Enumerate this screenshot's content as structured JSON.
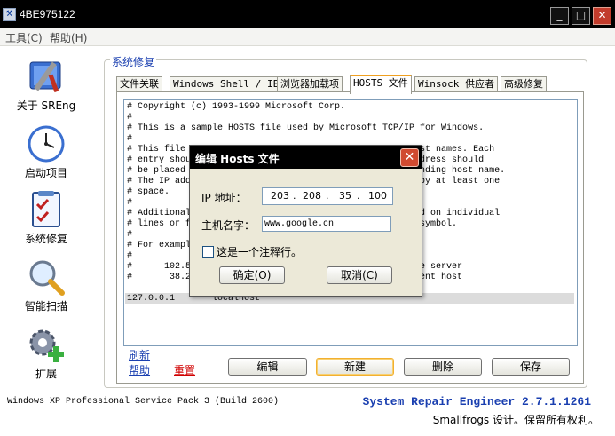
{
  "window": {
    "title": "4BE975122",
    "min": "_",
    "max": "□",
    "close": "✕"
  },
  "menu": [
    "工具(C)",
    "帮助(H)"
  ],
  "sidebar": [
    {
      "label": "关于 SREng",
      "icon": "tools-icon"
    },
    {
      "label": "启动项目",
      "icon": "clock-icon"
    },
    {
      "label": "系统修复",
      "icon": "checklist-icon"
    },
    {
      "label": "智能扫描",
      "icon": "magnifier-icon"
    },
    {
      "label": "扩展",
      "icon": "gear-plus-icon"
    }
  ],
  "group_title": "系统修复",
  "tabs": [
    "文件关联",
    "Windows Shell / IE",
    "浏览器加载项",
    "HOSTS 文件",
    "Winsock 供应者",
    "高级修复"
  ],
  "hosts_lines": [
    "# Copyright (c) 1993-1999 Microsoft Corp.",
    "#",
    "# This is a sample HOSTS file used by Microsoft TCP/IP for Windows.",
    "#",
    "# This file                                            st names. Each",
    "# entry shou                                           dress should",
    "# be placed                                            nding host name.",
    "# The IP add                                           by at least one",
    "# space.",
    "#",
    "# Additional                                           d on individual",
    "# lines or f                                           symbol.",
    "#",
    "# For exampl",
    "#",
    "#      102.5                                           e server",
    "#       38.2                                           ent host",
    "",
    "127.0.0.1       localhost"
  ],
  "links": {
    "refresh": "刷新",
    "help": "帮助",
    "reset": "重置"
  },
  "buttons": {
    "edit": "编辑",
    "new": "新建",
    "delete": "删除",
    "save": "保存"
  },
  "status": {
    "os": "Windows XP Professional Service Pack 3 (Build 2600)",
    "product": "System Repair Engineer 2.7.1.1261",
    "copyright": "Smallfrogs 设计。保留所有权利。"
  },
  "dialog": {
    "title": "编辑 Hosts 文件",
    "ip_label": "IP 地址：",
    "ip": [
      "203",
      "208",
      "35",
      "100"
    ],
    "ip_dot": ".",
    "host_label": "主机名字：",
    "host_value": "www.google.cn",
    "comment_label": "这是一个注释行。",
    "ok": "确定(O)",
    "cancel": "取消(C)"
  },
  "colors": {
    "accent": "#1a3fb0",
    "tab_highlight": "#f0a020",
    "reset_link": "#d00000"
  }
}
